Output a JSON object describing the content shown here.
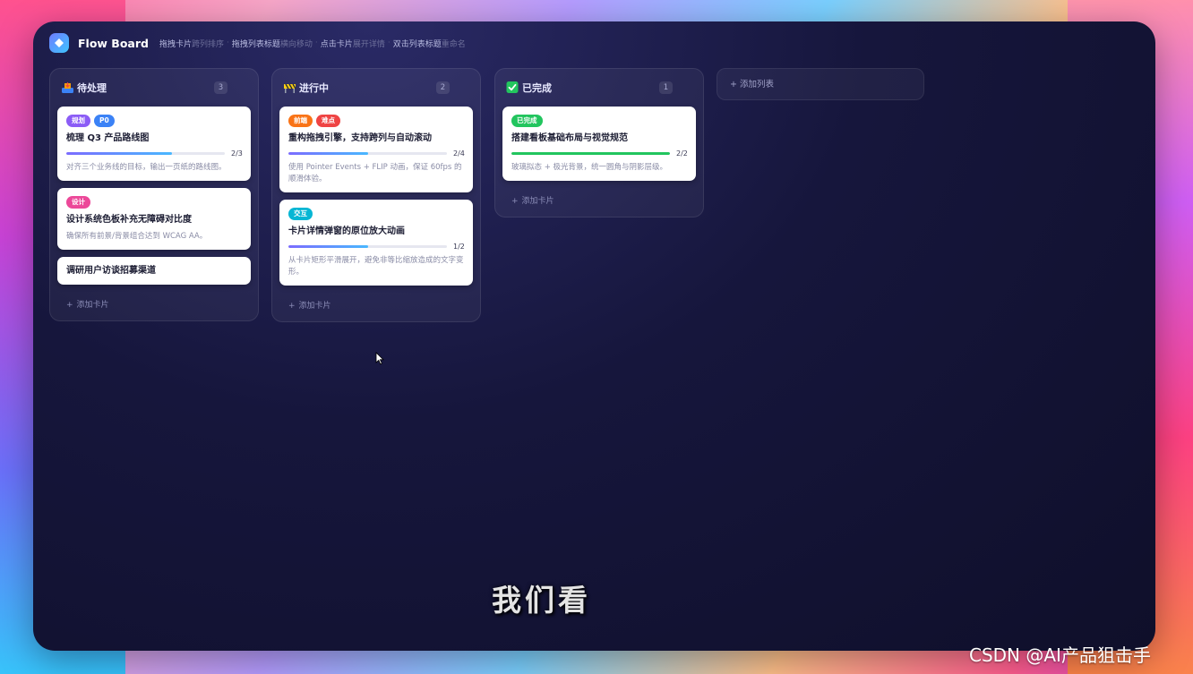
{
  "app": {
    "title": "Flow Board",
    "hints": [
      {
        "bold": "拖拽卡片",
        "dim": "跨列排序"
      },
      {
        "bold": "拖拽列表标题",
        "dim": "横向移动"
      },
      {
        "bold": "点击卡片",
        "dim": "展开详情"
      },
      {
        "bold": "双击列表标题",
        "dim": "重命名"
      }
    ],
    "hint_separator": "·"
  },
  "columns": [
    {
      "icon": "inbox-tray-icon",
      "title": "待处理",
      "count": "3",
      "add_label": "添加卡片",
      "cards": [
        {
          "tags": [
            {
              "label": "规划",
              "color": "#8b5cf6"
            },
            {
              "label": "P0",
              "color": "#3b82f6"
            }
          ],
          "title": "梳理 Q3 产品路线图",
          "progress": {
            "done": 2,
            "total": 3,
            "label": "2/3"
          },
          "desc": "对齐三个业务线的目标，输出一页纸的路线图。"
        },
        {
          "tags": [
            {
              "label": "设计",
              "color": "#ec4899"
            }
          ],
          "title": "设计系统色板补充无障碍对比度",
          "desc": "确保所有前景/背景组合达到 WCAG AA。"
        },
        {
          "title": "调研用户访谈招募渠道"
        }
      ]
    },
    {
      "icon": "construction-icon",
      "title": "进行中",
      "count": "2",
      "add_label": "添加卡片",
      "cards": [
        {
          "tags": [
            {
              "label": "前端",
              "color": "#f97316"
            },
            {
              "label": "难点",
              "color": "#ef4444"
            }
          ],
          "title": "重构拖拽引擎，支持跨列与自动滚动",
          "progress": {
            "done": 2,
            "total": 4,
            "label": "2/4"
          },
          "desc": "使用 Pointer Events + FLIP 动画，保证 60fps 的顺滑体验。"
        },
        {
          "tags": [
            {
              "label": "交互",
              "color": "#06b6d4"
            }
          ],
          "title": "卡片详情弹窗的原位放大动画",
          "progress": {
            "done": 1,
            "total": 2,
            "label": "1/2"
          },
          "desc": "从卡片矩形平滑展开，避免非等比缩放造成的文字变形。"
        }
      ]
    },
    {
      "icon": "check-mark-icon",
      "title": "已完成",
      "count": "1",
      "add_label": "添加卡片",
      "cards": [
        {
          "tags": [
            {
              "label": "已完成",
              "color": "#22c55e"
            }
          ],
          "title": "搭建看板基础布局与视觉规范",
          "progress": {
            "done": 2,
            "total": 2,
            "label": "2/2",
            "complete": true
          },
          "desc": "玻璃拟态 + 极光背景，统一圆角与阴影层级。"
        }
      ]
    }
  ],
  "add_list_label": "添加列表",
  "subtitle": "我们看",
  "watermark": "CSDN @AI产品狙击手"
}
